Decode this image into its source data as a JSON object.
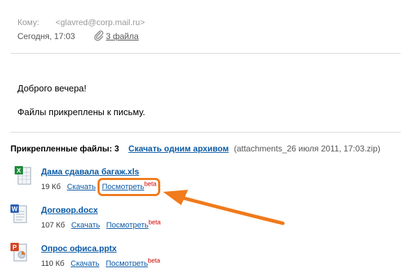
{
  "header": {
    "to_label": "Кому:",
    "to_address": "<glavred@corp.mail.ru>",
    "date": "Сегодня, 17:03",
    "files_link": "3 файла"
  },
  "message": {
    "greeting": "Доброго вечера!",
    "text": "Файлы прикреплены к письму."
  },
  "attachments": {
    "label": "Прикрепленные файлы:",
    "count": "3",
    "archive_link": "Скачать одним архивом",
    "archive_name": "(attachments_26 июля 2011, 17:03.zip)",
    "files": [
      {
        "name": "Дама сдавала багаж.xls",
        "size": "19 Кб",
        "download": "Скачать",
        "view": "Посмотреть",
        "badge": "beta",
        "icon": "excel-file-icon"
      },
      {
        "name": "Договор.docx",
        "size": "107 Кб",
        "download": "Скачать",
        "view": "Посмотреть",
        "badge": "beta",
        "icon": "word-file-icon"
      },
      {
        "name": "Опрос офиса.pptx",
        "size": "110 Кб",
        "download": "Скачать",
        "view": "Посмотреть",
        "badge": "beta",
        "icon": "powerpoint-file-icon"
      }
    ]
  },
  "colors": {
    "link": "#0a5aa6",
    "beta": "#d40000",
    "highlight": "#f07a1c"
  }
}
